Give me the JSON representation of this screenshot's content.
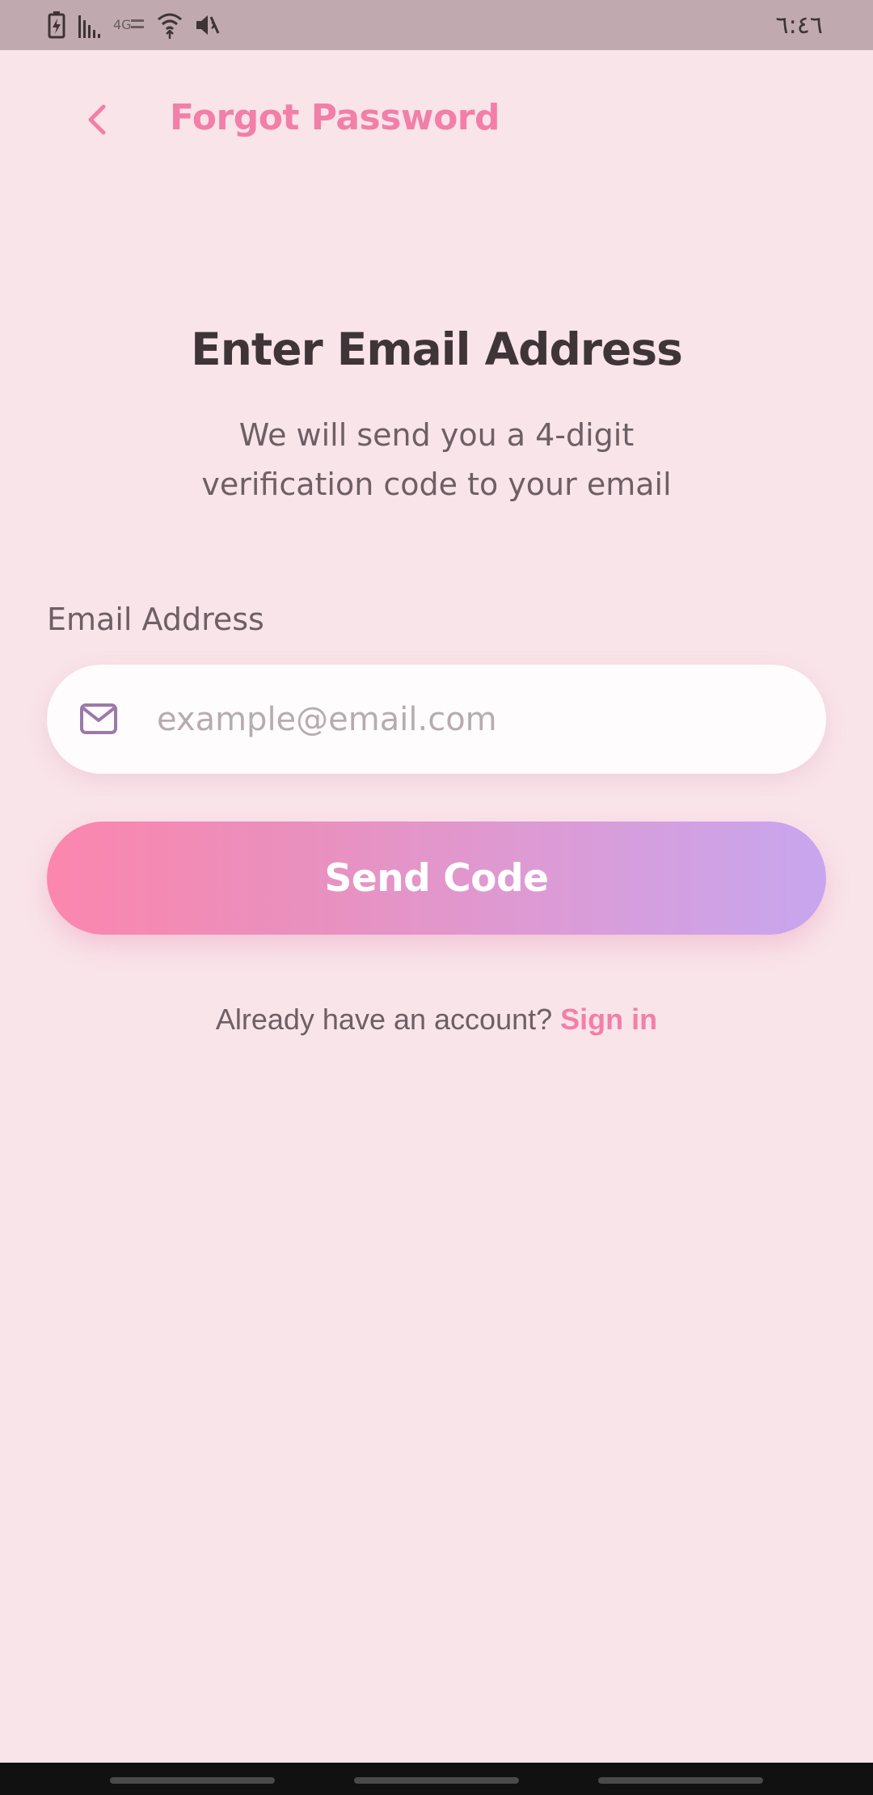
{
  "status_bar": {
    "time": "٦:٤٦",
    "icons": [
      "battery-icon",
      "signal-icon",
      "network-4g-icon",
      "wifi-icon",
      "mute-icon"
    ]
  },
  "header": {
    "back_icon": "chevron-left-icon",
    "title": "Forgot Password"
  },
  "content": {
    "title": "Enter Email Address",
    "subtitle": "We will send you a 4-digit verification code to your email"
  },
  "form": {
    "email_label": "Email Address",
    "email_value": "",
    "email_placeholder": "example@email.com",
    "email_icon": "mail-icon",
    "submit_label": "Send Code"
  },
  "footer": {
    "prompt": "Already have an account?",
    "link": "Sign in"
  },
  "colors": {
    "background": "#f9e4ea",
    "accent": "#f27fa8",
    "gradient_start": "#fc86ad",
    "gradient_end": "#c7a6ef",
    "icon_purple": "#9c79a8"
  }
}
